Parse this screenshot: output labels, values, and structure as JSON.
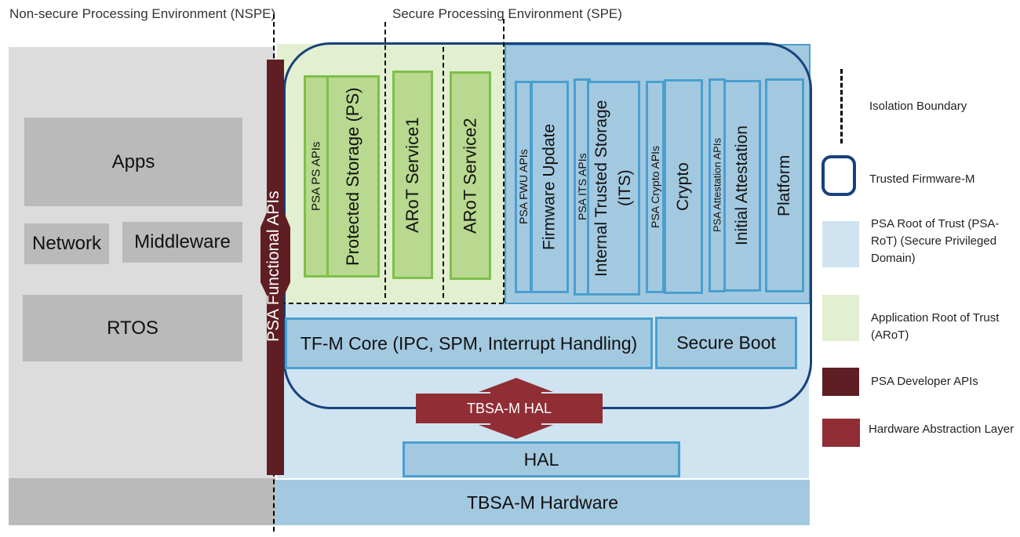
{
  "headers": {
    "nspe": "Non-secure Processing Environment (NSPE)",
    "spe": "Secure Processing Environment (SPE)"
  },
  "nspe": {
    "apps": "Apps",
    "network": "Network",
    "middleware": "Middleware",
    "rtos": "RTOS"
  },
  "psa_functional_apis": "PSA Functional APIs",
  "arot": {
    "ps_apis": "PSA PS APIs",
    "ps": "Protected Storage (PS)",
    "service1": "ARoT Service1",
    "service2": "ARoT Service2"
  },
  "psa_rot": {
    "fwu_apis": "PSA FWU APIs",
    "fwu": "Firmware Update",
    "its_apis": "PSA ITS APIs",
    "its": "Internal Trusted Storage (ITS)",
    "crypto_apis": "PSA Crypto APIs",
    "crypto": "Crypto",
    "attest_apis": "PSA Attestation APIs",
    "attest": "Initial Attestation",
    "platform": "Platform"
  },
  "core": {
    "tfm_core": "TF-M Core (IPC, SPM, Interrupt Handling)",
    "secure_boot": "Secure Boot",
    "tbsa_hal": "TBSA-M HAL",
    "hal": "HAL",
    "hardware": "TBSA-M Hardware"
  },
  "legend": {
    "isolation": "Isolation Boundary",
    "tfm": "Trusted Firmware-M",
    "psa_rot": "PSA Root of Trust (PSA-RoT) (Secure Privileged Domain)",
    "arot": "Application Root of Trust (ARoT)",
    "dev_apis": "PSA Developer APIs",
    "hal": "Hardware Abstraction Layer"
  },
  "colors": {
    "nspe_bg": "#dcdcdc",
    "gray_box": "#bababa",
    "arot_bg": "#e2efd0",
    "psa_rot_bg": "#cfe4f0",
    "blue_box": "#a3c9e0",
    "tfm_border": "#17427c",
    "dev_api": "#5f1d24",
    "hal_red": "#912d35"
  }
}
